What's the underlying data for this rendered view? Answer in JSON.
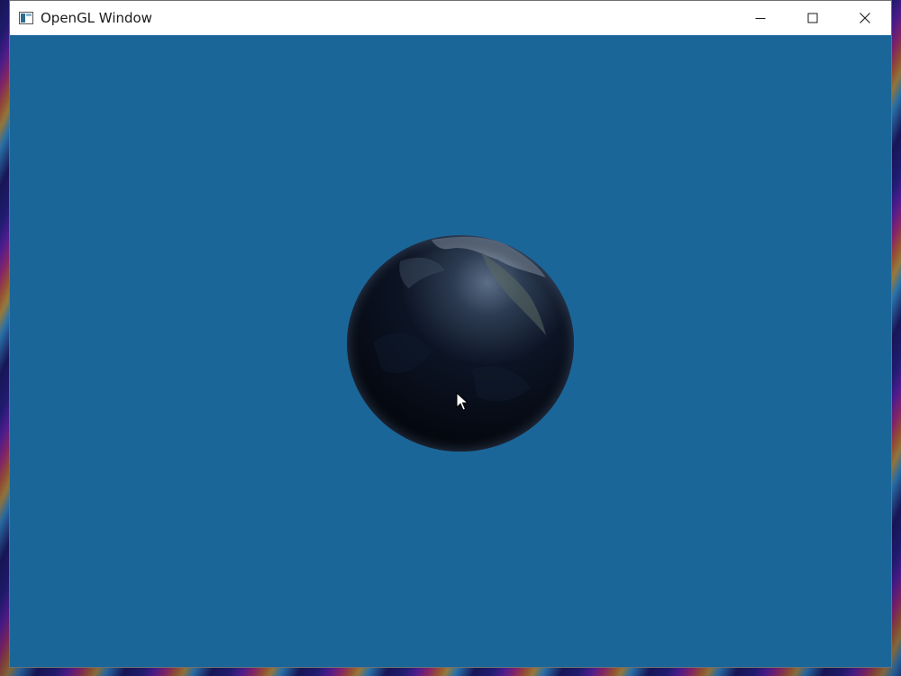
{
  "window": {
    "title": "OpenGL Window",
    "app_icon": "app-window-icon",
    "controls": {
      "minimize": "minimize-icon",
      "maximize": "maximize-icon",
      "close": "close-icon"
    }
  },
  "scene": {
    "background_color": "#1b6699",
    "object": "earth-globe",
    "cursor": "mouse-pointer-icon"
  }
}
